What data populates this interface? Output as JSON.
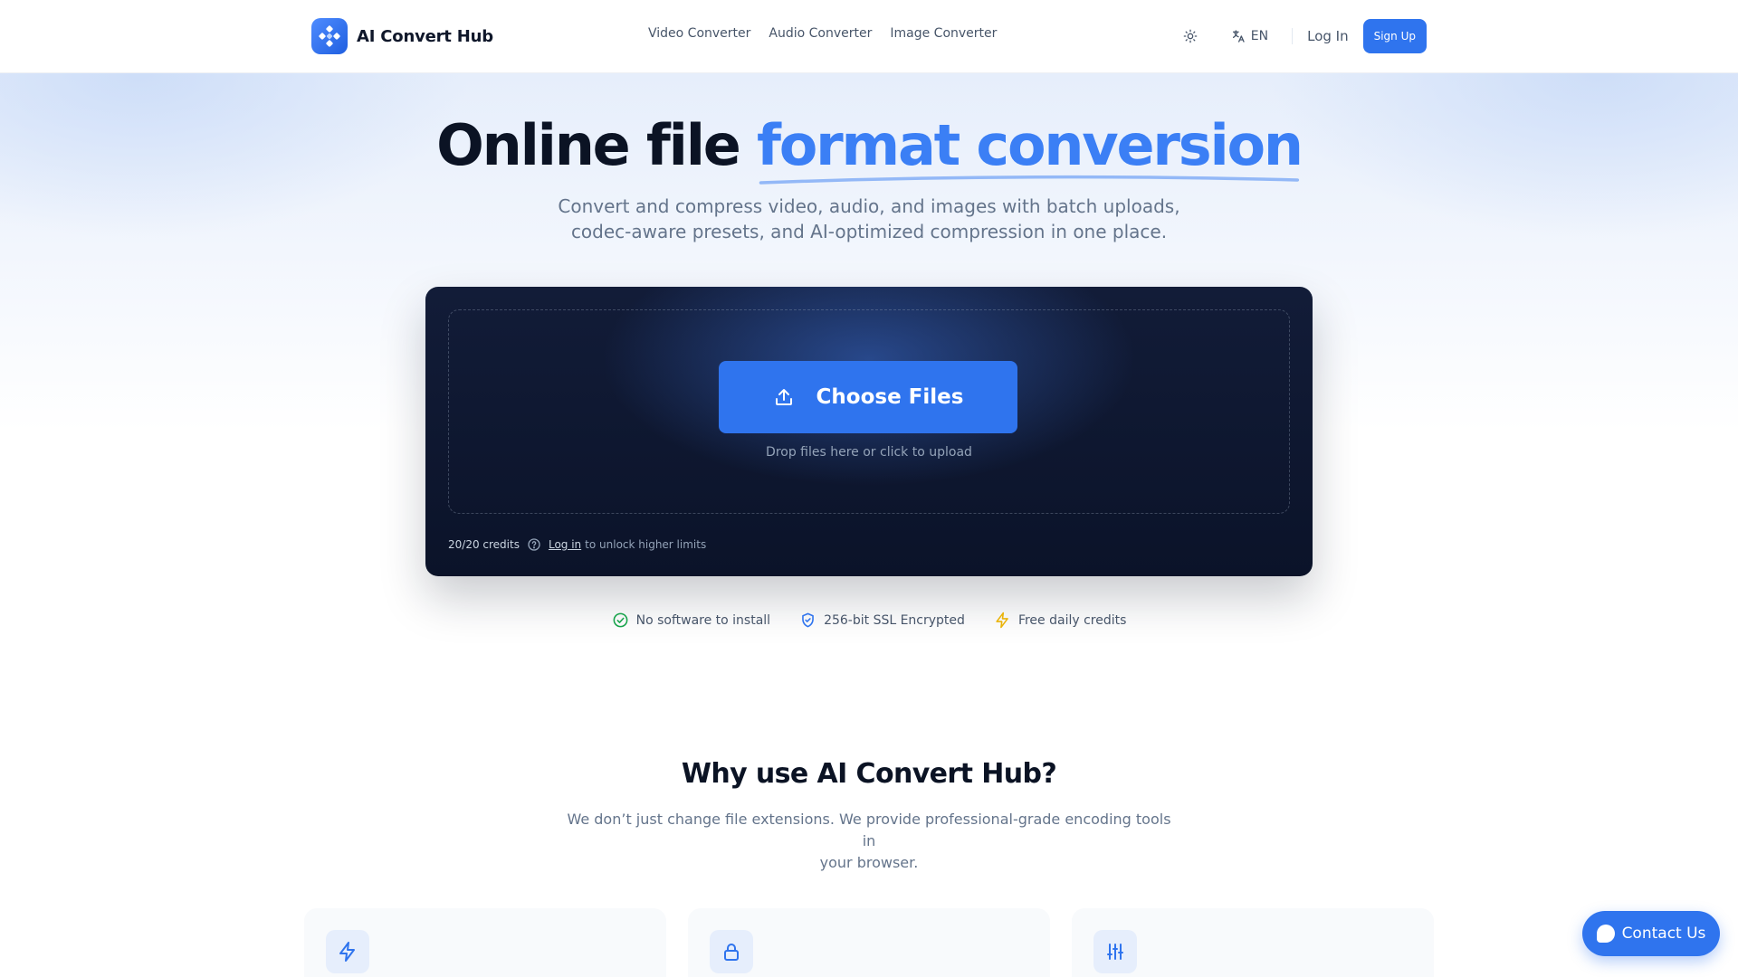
{
  "brand": {
    "name": "AI Convert Hub",
    "accent_color": "#2f74ee"
  },
  "nav": {
    "items": [
      {
        "label": "Video Converter"
      },
      {
        "label": "Audio Converter"
      },
      {
        "label": "Image Converter"
      }
    ]
  },
  "header": {
    "theme_icon": "sun-icon",
    "language": "EN",
    "login_label": "Log In",
    "signup_label": "Sign Up"
  },
  "hero": {
    "title_plain": "Online file ",
    "title_accent": "format conversion",
    "subtitle_line1": "Convert and compress video, audio, and images with batch uploads,",
    "subtitle_line2": "codec-aware presets, and AI-optimized compression in one place."
  },
  "upload": {
    "button_label": "Choose Files",
    "hint": "Drop files here or click to upload",
    "credits": "20/20 credits",
    "login_link": "Log in",
    "unlock_text": "to unlock higher limits"
  },
  "badges": [
    {
      "icon": "check-circle-icon",
      "label": "No software to install",
      "color": "#16a34a"
    },
    {
      "icon": "shield-icon",
      "label": "256-bit SSL Encrypted",
      "color": "#2f74ee"
    },
    {
      "icon": "lightning-icon",
      "label": "Free daily credits",
      "color": "#eab308"
    }
  ],
  "why": {
    "title": "Why use AI Convert Hub?",
    "subtitle_line1": "We don’t just change file extensions. We provide professional-grade encoding tools in",
    "subtitle_line2": "your browser."
  },
  "features": [
    {
      "icon": "lightning-icon"
    },
    {
      "icon": "lock-icon"
    },
    {
      "icon": "sliders-icon"
    }
  ],
  "contact": {
    "label": "Contact Us"
  }
}
